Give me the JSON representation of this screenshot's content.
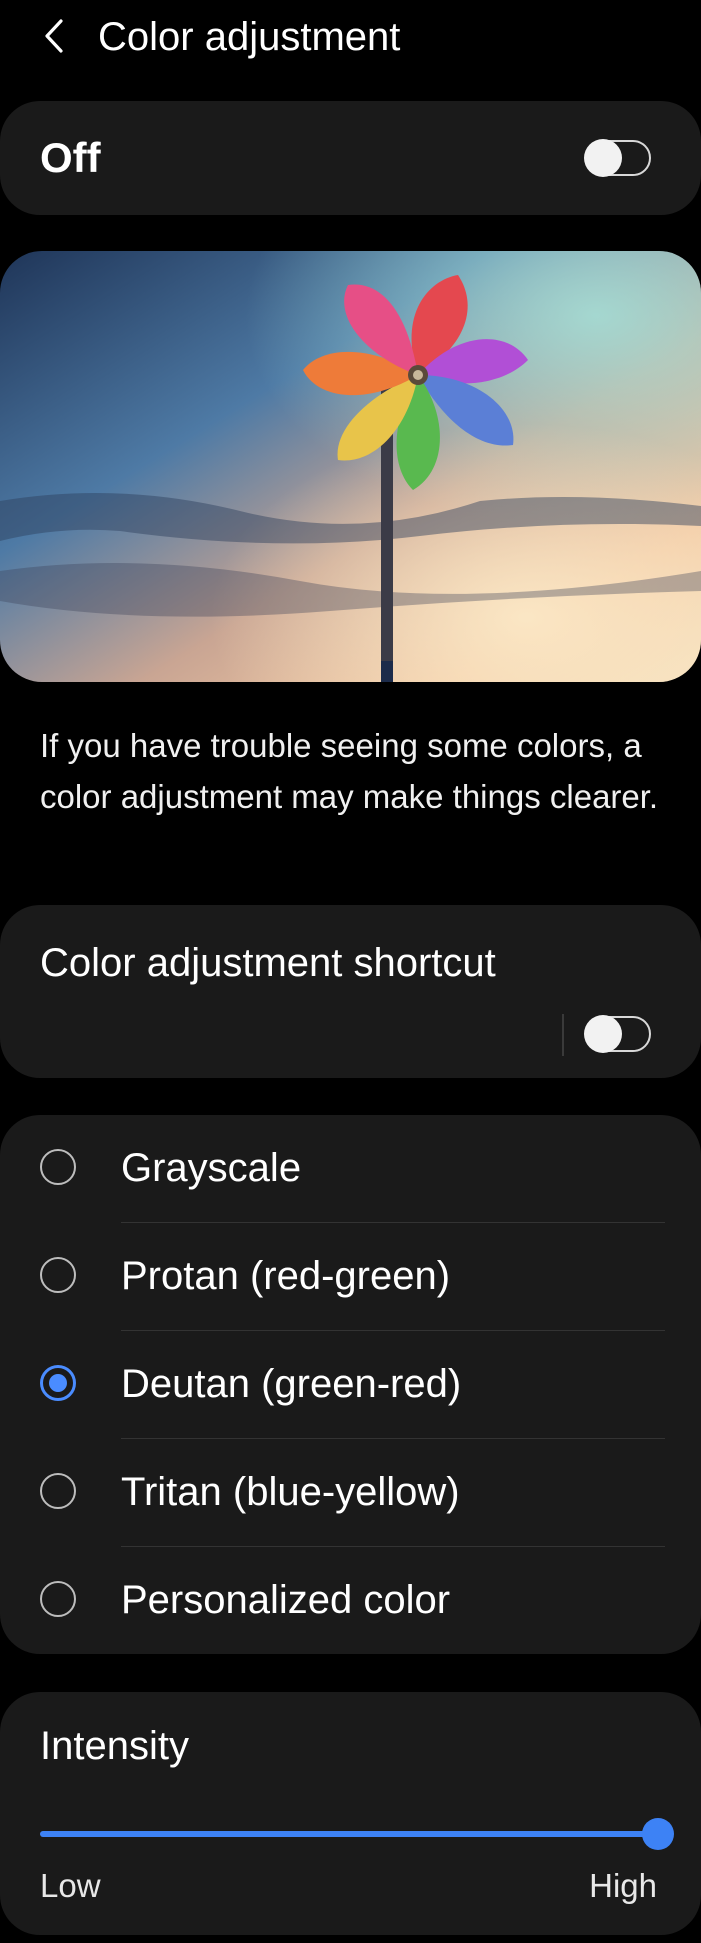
{
  "header": {
    "title": "Color adjustment"
  },
  "master_switch": {
    "label": "Off",
    "on": false
  },
  "description": "If you have trouble seeing some colors, a color adjustment may make things clearer.",
  "shortcut": {
    "label": "Color adjustment shortcut",
    "on": false
  },
  "options": {
    "items": [
      {
        "label": "Grayscale",
        "selected": false
      },
      {
        "label": "Protan (red-green)",
        "selected": false
      },
      {
        "label": "Deutan (green-red)",
        "selected": true
      },
      {
        "label": "Tritan (blue-yellow)",
        "selected": false
      },
      {
        "label": "Personalized color",
        "selected": false
      }
    ]
  },
  "intensity": {
    "label": "Intensity",
    "low_label": "Low",
    "high_label": "High",
    "level": 1.0
  },
  "colors": {
    "accent": "#3d82f5",
    "card": "#1a1a1a",
    "background": "#000000"
  }
}
